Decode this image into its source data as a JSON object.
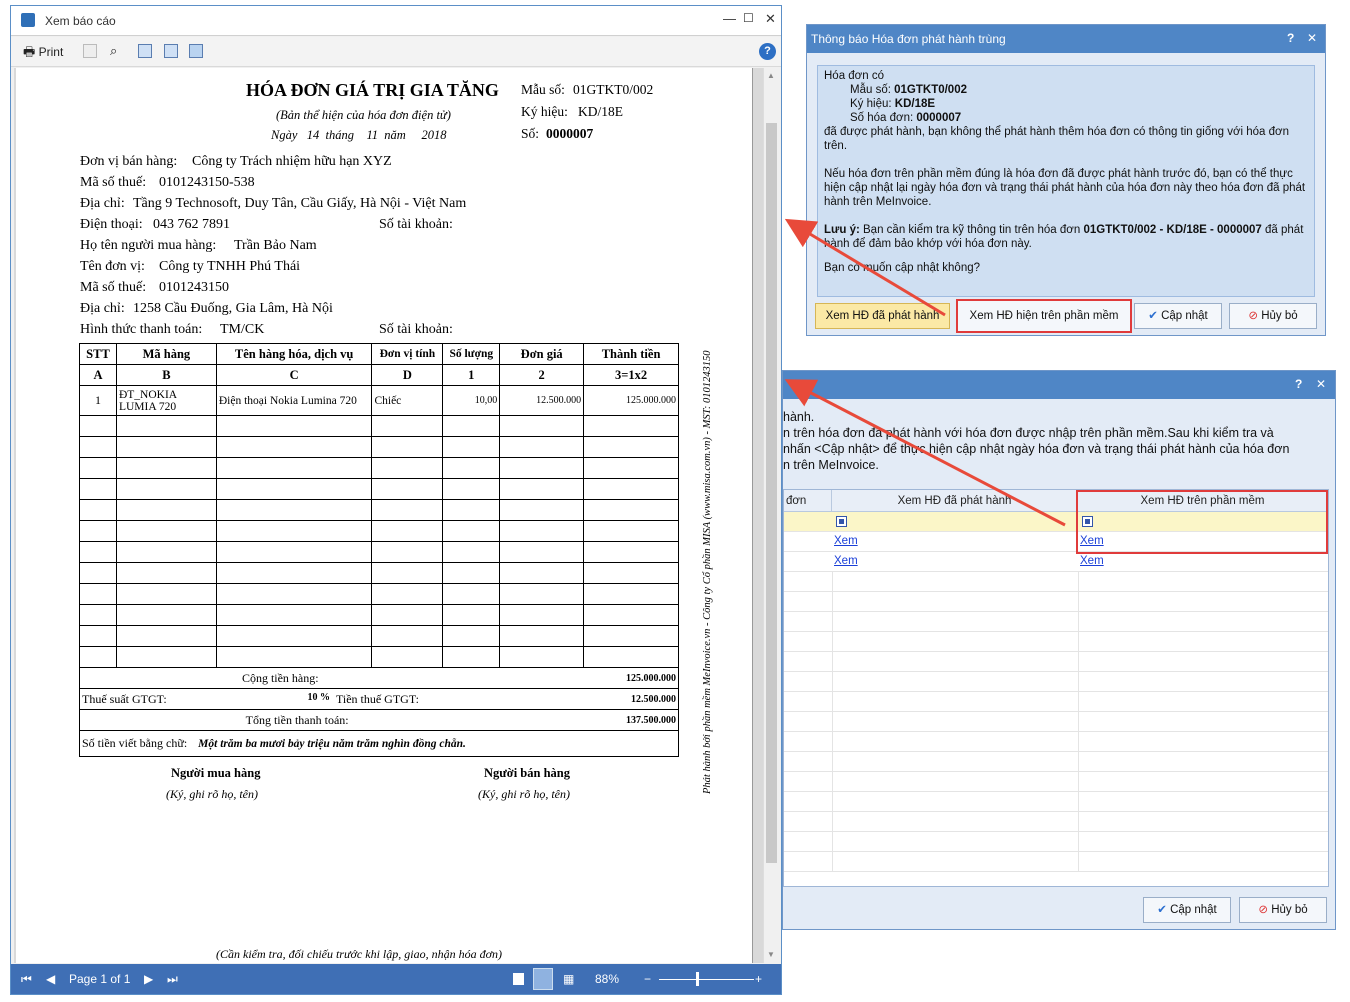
{
  "report_window": {
    "title": "Xem báo cáo",
    "toolbar": {
      "print_label": "Print"
    },
    "status": {
      "page_label": "Page 1 of 1",
      "zoom": "88%"
    }
  },
  "invoice": {
    "title": "HÓA ĐƠN GIÁ TRỊ GIA TĂNG",
    "subtitle": "(Bản thể hiện của hóa đơn điện tử)",
    "date_line": "Ngày   14  tháng    11  năm     2018",
    "form_label": "Mẫu số:",
    "form_value": "01GTKT0/002",
    "symbol_label": "Ký hiệu:",
    "symbol_value": "KD/18E",
    "number_label": "Số:",
    "number_value": "0000007",
    "seller_label": "Đơn vị bán hàng:",
    "seller": "Công ty Trách nhiệm hữu hạn XYZ",
    "seller_tax_label": "Mã số thuế:",
    "seller_tax": "0101243150-538",
    "seller_addr_label": "Địa chỉ:",
    "seller_addr": "Tầng 9 Technosoft, Duy Tân, Cầu Giấy, Hà Nội - Việt Nam",
    "phone_label": "Điện thoại:",
    "phone": "043 762 7891",
    "account_label": "Số tài khoản:",
    "buyer_label": "Họ tên người mua hàng:",
    "buyer": "Trần Bảo Nam",
    "buyer_unit_label": "Tên đơn vị:",
    "buyer_unit": "Công ty TNHH Phú Thái",
    "buyer_tax_label": "Mã số thuế:",
    "buyer_tax": "0101243150",
    "buyer_addr_label": "Địa chỉ:",
    "buyer_addr": "1258 Cầu Đuống, Gia Lâm, Hà Nội",
    "payment_label": "Hình thức thanh toán:",
    "payment": "TM/CK",
    "columns": [
      "STT",
      "Mã hàng",
      "Tên hàng hóa, dịch vụ",
      "Đơn vị tính",
      "Số lượng",
      "Đơn giá",
      "Thành tiền"
    ],
    "column_codes": [
      "A",
      "B",
      "C",
      "D",
      "1",
      "2",
      "3=1x2"
    ],
    "items": [
      {
        "stt": "1",
        "code": "ĐT_NOKIA LUMIA 720",
        "name": "Điện thoại Nokia Lumina 720",
        "unit": "Chiếc",
        "qty": "10,00",
        "price": "12.500.000",
        "amount": "125.000.000"
      }
    ],
    "subtotal_label": "Cộng tiền hàng:",
    "subtotal": "125.000.000",
    "vat_rate_label": "Thuế suất GTGT:",
    "vat_rate": "10 %",
    "vat_label": "Tiền thuế GTGT:",
    "vat": "12.500.000",
    "total_label": "Tổng tiền thanh toán:",
    "total": "137.500.000",
    "words_label": "Số tiền viết bằng chữ:",
    "words": "Một trăm ba mươi bảy triệu năm trăm nghìn đồng chẵn.",
    "buyer_sign": "Người mua hàng",
    "seller_sign": "Người bán hàng",
    "sign_note": "(Ký, ghi rõ họ, tên)",
    "footer_note": "(Cần kiểm tra, đối chiếu trước khi lập, giao, nhận hóa đơn)",
    "side_text": "Phát hành bởi phần mềm MeInvoice.vn - Công ty Cổ phần MISA (www.misa.com.vn) - MST: 0101243150"
  },
  "dialog1": {
    "title": "Thông báo Hóa đơn phát hành trùng",
    "line_intro": "Hóa đơn có",
    "form_label": "Mẫu số:",
    "form_value": "01GTKT0/002",
    "symbol_label": "Ký hiệu:",
    "symbol_value": "KD/18E",
    "number_label": "Số hóa đơn:",
    "number_value": "0000007",
    "msg1": "đã được phát hành, bạn không thể phát hành thêm hóa đơn có thông tin giống với hóa đơn trên.",
    "msg2": "Nếu hóa đơn trên phần mềm đúng là hóa đơn đã được phát hành trước đó, bạn có thể thực hiện cập nhật lại ngày hóa đơn và trạng thái phát hành của hóa đơn này theo hóa đơn đã phát hành trên MeInvoice.",
    "note_label": "Lưu ý:",
    "note_text": "Bạn cần kiểm tra kỹ thông tin trên hóa đơn",
    "note_bold": "01GTKT0/002 - KD/18E - 0000007",
    "note_tail": "đã phát hành để đảm bảo khớp với hóa đơn này.",
    "question": "Bạn có muốn cập nhật không?",
    "buttons": {
      "view_issued": "Xem HĐ đã phát hành",
      "view_software": "Xem HĐ hiện trên phần mềm",
      "update": "Cập nhật",
      "cancel": "Hủy bỏ"
    }
  },
  "dialog2": {
    "text_line1": "hành.",
    "text_line2": "n trên hóa đơn đã phát hành với hóa đơn được nhập trên phần mềm.Sau khi kiểm tra và",
    "text_line3": "nhấn <Cập nhật> để thực hiện cập nhật ngày hóa đơn và trạng thái phát hành của hóa đơn",
    "text_line4": "n trên MeInvoice.",
    "col_partial": "đơn",
    "col_issued": "Xem HĐ đã phát hành",
    "col_software": "Xem HĐ trên phần mềm",
    "link_label": "Xem",
    "buttons": {
      "update": "Cập nhật",
      "cancel": "Hủy bỏ"
    }
  }
}
